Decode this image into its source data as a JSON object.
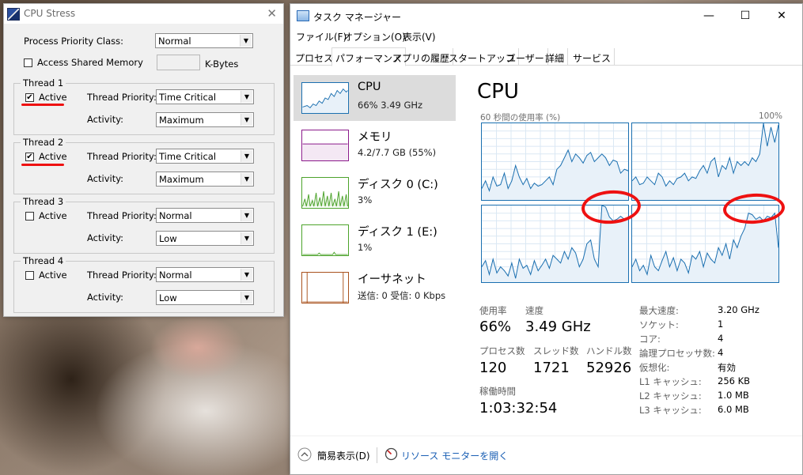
{
  "cpu_stress": {
    "title": "CPU Stress",
    "close": "✕",
    "priority_class_label": "Process Priority Class:",
    "priority_class_value": "Normal",
    "shared_memory_label": "Access Shared Memory",
    "kbytes_label": "K-Bytes",
    "threads": [
      {
        "legend": "Thread 1",
        "active_label": "Active",
        "active": "✔",
        "priority_label": "Thread Priority:",
        "priority": "Time Critical",
        "activity_label": "Activity:",
        "activity": "Maximum"
      },
      {
        "legend": "Thread 2",
        "active_label": "Active",
        "active": "✔",
        "priority_label": "Thread Priority:",
        "priority": "Time Critical",
        "activity_label": "Activity:",
        "activity": "Maximum"
      },
      {
        "legend": "Thread 3",
        "active_label": "Active",
        "active": "",
        "priority_label": "Thread Priority:",
        "priority": "Normal",
        "activity_label": "Activity:",
        "activity": "Low"
      },
      {
        "legend": "Thread 4",
        "active_label": "Active",
        "active": "",
        "priority_label": "Thread Priority:",
        "priority": "Normal",
        "activity_label": "Activity:",
        "activity": "Low"
      }
    ],
    "dropdown_arrow": "▼"
  },
  "task_manager": {
    "title": "タスク マネージャー",
    "minimize": "—",
    "maximize": "☐",
    "close": "✕",
    "menu": [
      "ファイル(F)",
      "オプション(O)",
      "表示(V)"
    ],
    "tabs": [
      "プロセス",
      "パフォーマンス",
      "アプリの履歴",
      "スタートアップ",
      "ユーザー",
      "詳細",
      "サービス"
    ],
    "resources": [
      {
        "name": "CPU",
        "sub": "66%  3.49 GHz"
      },
      {
        "name": "メモリ",
        "sub": "4.2/7.7 GB (55%)"
      },
      {
        "name": "ディスク 0 (C:)",
        "sub": "3%"
      },
      {
        "name": "ディスク 1 (E:)",
        "sub": "1%"
      },
      {
        "name": "イーサネット",
        "sub": "送信: 0 受信: 0 Kbps"
      }
    ],
    "detail": {
      "heading": "CPU",
      "graph_caption_left": "60 秒間の使用率 (%)",
      "graph_caption_right": "100%",
      "stats": [
        {
          "label": "使用率",
          "value": "66%"
        },
        {
          "label": "速度",
          "value": "3.49 GHz"
        },
        {
          "label": "プロセス数",
          "value": "120"
        },
        {
          "label": "スレッド数",
          "value": "1721"
        },
        {
          "label": "ハンドル数",
          "value": "52926"
        },
        {
          "label": "稼働時間",
          "value": "1:03:32:54"
        }
      ],
      "specs": [
        {
          "label": "最大速度:",
          "value": "3.20 GHz"
        },
        {
          "label": "ソケット:",
          "value": "1"
        },
        {
          "label": "コア:",
          "value": "4"
        },
        {
          "label": "論理プロセッサ数:",
          "value": "4"
        },
        {
          "label": "仮想化:",
          "value": "有効"
        },
        {
          "label": "L1 キャッシュ:",
          "value": "256 KB"
        },
        {
          "label": "L2 キャッシュ:",
          "value": "1.0 MB"
        },
        {
          "label": "L3 キャッシュ:",
          "value": "6.0 MB"
        }
      ]
    },
    "footer": {
      "fewer_details": "簡易表示(D)",
      "resource_monitor": "リソース モニターを開く"
    },
    "colors": {
      "cpu_line": "#1a6fb0",
      "cpu_fill": "#e8f1f9",
      "memory": "#8b1a8b",
      "disk": "#4ca32b",
      "ethernet": "#a9521d"
    }
  },
  "chart_data": [
    {
      "type": "area",
      "series": [
        {
          "values": [
            0.15,
            0.25,
            0.12,
            0.3,
            0.18,
            0.2,
            0.35,
            0.15,
            0.25,
            0.45,
            0.3,
            0.2,
            0.28,
            0.15,
            0.22,
            0.18,
            0.2,
            0.25,
            0.3,
            0.2,
            0.4,
            0.45,
            0.55,
            0.65,
            0.5,
            0.6,
            0.55,
            0.48,
            0.58,
            0.62,
            0.5,
            0.55,
            0.6,
            0.55,
            0.45,
            0.52,
            0.5,
            0.35,
            0.4,
            0.38
          ]
        }
      ],
      "ylim": [
        0,
        1
      ]
    },
    {
      "type": "area",
      "series": [
        {
          "values": [
            0.25,
            0.3,
            0.2,
            0.22,
            0.3,
            0.25,
            0.2,
            0.35,
            0.3,
            0.18,
            0.25,
            0.2,
            0.28,
            0.3,
            0.35,
            0.25,
            0.3,
            0.28,
            0.38,
            0.45,
            0.35,
            0.5,
            0.55,
            0.3,
            0.45,
            0.4,
            0.55,
            0.35,
            0.5,
            0.45,
            0.5,
            0.45,
            0.55,
            0.5,
            0.6,
            1.0,
            0.7,
            0.95,
            0.75,
            0.98
          ]
        }
      ],
      "ylim": [
        0,
        1
      ]
    },
    {
      "type": "area",
      "series": [
        {
          "values": [
            0.2,
            0.28,
            0.1,
            0.3,
            0.12,
            0.2,
            0.15,
            0.08,
            0.25,
            0.05,
            0.3,
            0.18,
            0.22,
            0.1,
            0.28,
            0.15,
            0.22,
            0.3,
            0.18,
            0.35,
            0.3,
            0.25,
            0.4,
            0.3,
            0.45,
            0.38,
            0.2,
            0.3,
            0.5,
            0.55,
            0.3,
            0.2,
            1.0,
            0.98,
            0.85,
            0.8,
            0.82,
            0.86,
            0.82,
            0.85
          ]
        }
      ],
      "ylim": [
        0,
        1
      ]
    },
    {
      "type": "area",
      "series": [
        {
          "values": [
            0.2,
            0.3,
            0.15,
            0.22,
            0.1,
            0.35,
            0.2,
            0.15,
            0.28,
            0.4,
            0.2,
            0.32,
            0.15,
            0.3,
            0.25,
            0.12,
            0.35,
            0.3,
            0.4,
            0.2,
            0.38,
            0.3,
            0.25,
            0.45,
            0.35,
            0.5,
            0.3,
            0.55,
            0.45,
            0.6,
            0.7,
            0.9,
            0.88,
            0.82,
            0.85,
            0.8,
            0.86,
            0.84,
            0.9,
            0.45
          ]
        }
      ],
      "ylim": [
        0,
        1
      ]
    }
  ]
}
